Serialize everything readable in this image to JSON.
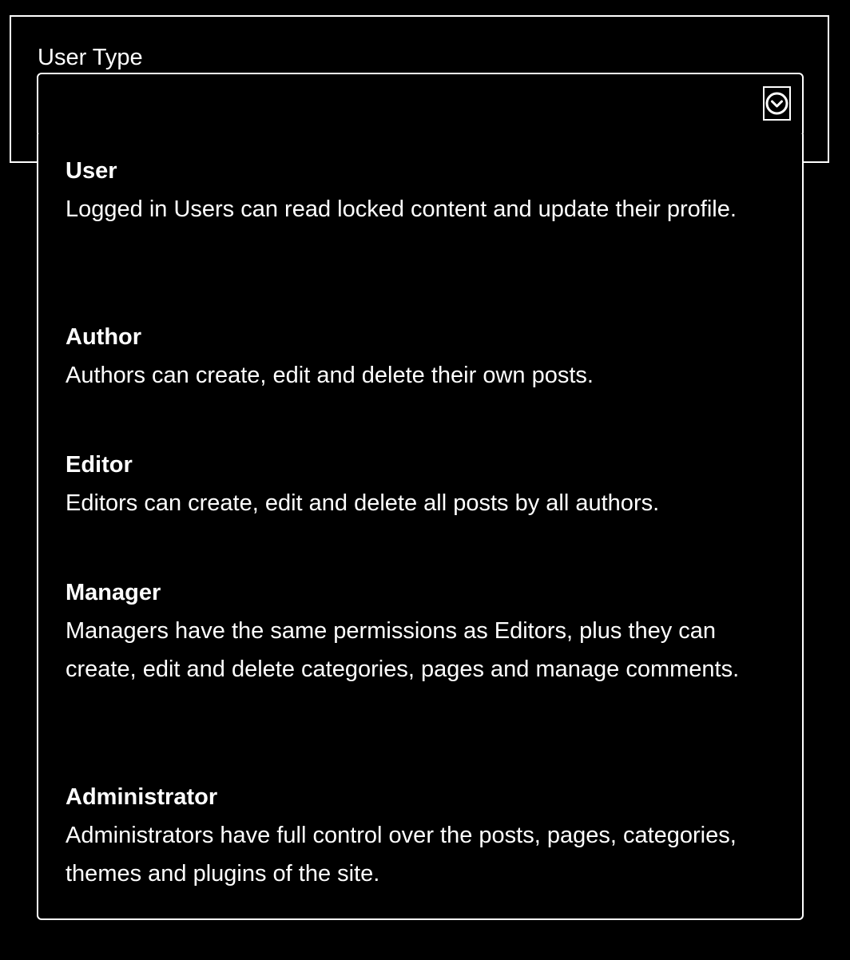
{
  "field": {
    "label": "User Type",
    "selected_value": ""
  },
  "select": {
    "toggle_icon": "chevron-down-circle-icon"
  },
  "options": [
    {
      "title": "User",
      "description": "Logged in Users can read locked content and update their profile."
    },
    {
      "title": "Author",
      "description": "Authors can create, edit and delete their own posts."
    },
    {
      "title": "Editor",
      "description": "Editors can create, edit and delete all posts by all authors."
    },
    {
      "title": "Manager",
      "description": "Managers have the same permissions as Editors, plus they can create, edit and delete categories, pages and manage comments."
    },
    {
      "title": "Administrator",
      "description": "Administrators have full control over the posts, pages, categories, themes and plugins of the site."
    }
  ],
  "colors": {
    "background": "#000000",
    "foreground": "#ffffff"
  }
}
